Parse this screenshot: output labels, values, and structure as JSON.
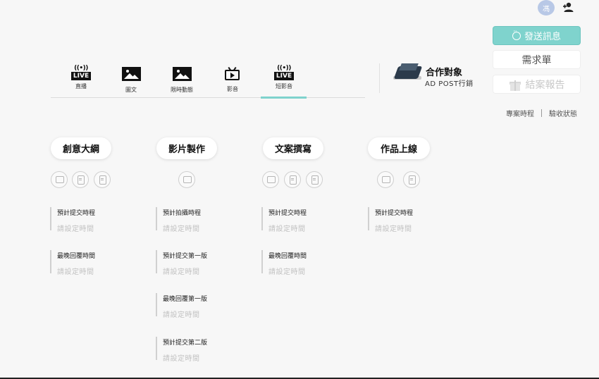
{
  "user": {
    "avatar_initial": "馮",
    "add_user_icon": "person-add-icon"
  },
  "actions": {
    "send_message": "發送訊息",
    "request_form": "需求單",
    "close_report": "結案報告"
  },
  "sublinks": [
    "專案時程",
    "驗收狀態"
  ],
  "tabs": [
    {
      "label": "直播",
      "icon": "live-icon",
      "badge": "LIVE"
    },
    {
      "label": "圖文",
      "icon": "image-icon"
    },
    {
      "label": "限時動態",
      "icon": "image-icon"
    },
    {
      "label": "影音",
      "icon": "tv-play-icon"
    },
    {
      "label": "短影音",
      "icon": "live-icon",
      "badge": "LIVE",
      "active": true
    }
  ],
  "partner": {
    "title": "合作對象",
    "subtitle": "AD POST行銷"
  },
  "columns": [
    {
      "title": "創意大綱",
      "fields": [
        {
          "label": "預計提交時程",
          "value": "請設定時間"
        },
        {
          "label": "最晚回覆時間",
          "value": "請設定時間"
        }
      ]
    },
    {
      "title": "影片製作",
      "fields": [
        {
          "label": "預計拍攝時程",
          "value": "請設定時間"
        },
        {
          "label": "預計提交第一版",
          "value": "請設定時間"
        },
        {
          "label": "最晚回覆第一版",
          "value": "請設定時間"
        },
        {
          "label": "預計提交第二版",
          "value": "請設定時間"
        }
      ]
    },
    {
      "title": "文案撰寫",
      "fields": [
        {
          "label": "預計提交時程",
          "value": "請設定時間"
        },
        {
          "label": "最晚回覆時間",
          "value": "請設定時間"
        }
      ]
    },
    {
      "title": "作品上線",
      "fields": [
        {
          "label": "預計提交時程",
          "value": "請設定時間"
        }
      ]
    }
  ],
  "colors": {
    "accent": "#7fd3cd",
    "placeholder": "#c2c2c2"
  }
}
